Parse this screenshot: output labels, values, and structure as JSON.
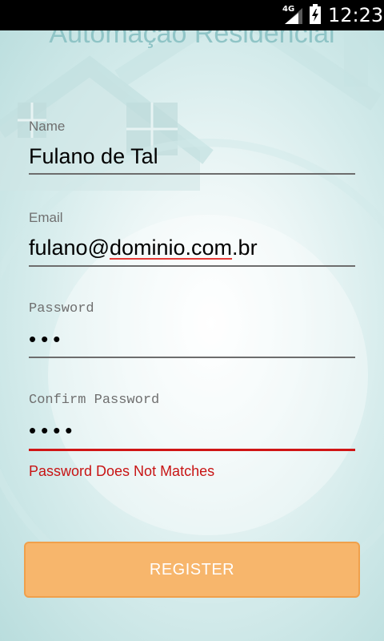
{
  "status_bar": {
    "network": "4G",
    "time": "12:23"
  },
  "app": {
    "title": "Automação Residencial"
  },
  "form": {
    "name": {
      "label": "Name",
      "value": "Fulano de Tal"
    },
    "email": {
      "label": "Email",
      "value_user": "fulano@",
      "value_domain": "dominio.com",
      "value_tld": ".br"
    },
    "password": {
      "label": "Password",
      "value": "•••"
    },
    "confirm_password": {
      "label": "Confirm Password",
      "value": "••••"
    },
    "error_message": "Password Does Not Matches",
    "register_label": "REGISTER"
  },
  "colors": {
    "button_fill": "#f7b66c",
    "error": "#c81414",
    "title": "#8fc4c6",
    "background_teal": "#b9dddd"
  }
}
